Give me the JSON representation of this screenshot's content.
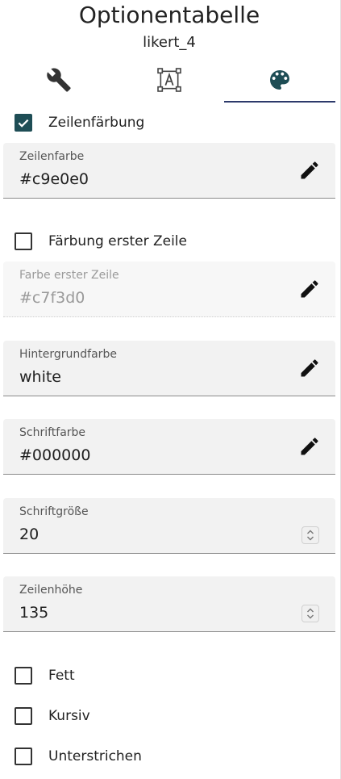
{
  "header": {
    "title": "Optionentabelle",
    "subtitle": "likert_4"
  },
  "tabs": [
    {
      "icon": "wrench-icon",
      "active": false
    },
    {
      "icon": "text-box-icon",
      "active": false
    },
    {
      "icon": "palette-icon",
      "active": true
    }
  ],
  "colors": {
    "accent": "#1e4d55",
    "tab_indicator": "#2d3a6b",
    "field_bg": "#f2f2f2"
  },
  "row_coloring": {
    "label": "Zeilenfärbung",
    "checked": true
  },
  "row_color": {
    "label": "Zeilenfarbe",
    "value": "#c9e0e0"
  },
  "first_row_coloring": {
    "label": "Färbung erster Zeile",
    "checked": false
  },
  "first_row_color": {
    "label": "Farbe erster Zeile",
    "value": "#c7f3d0",
    "disabled": true
  },
  "background_color": {
    "label": "Hintergrundfarbe",
    "value": "white"
  },
  "font_color": {
    "label": "Schriftfarbe",
    "value": "#000000"
  },
  "font_size": {
    "label": "Schriftgröße",
    "value": "20"
  },
  "row_height": {
    "label": "Zeilenhöhe",
    "value": "135"
  },
  "bold": {
    "label": "Fett",
    "checked": false
  },
  "italic": {
    "label": "Kursiv",
    "checked": false
  },
  "underline": {
    "label": "Unterstrichen",
    "checked": false
  }
}
